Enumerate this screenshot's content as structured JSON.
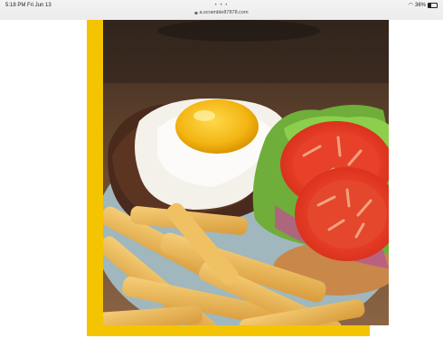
{
  "status_bar": {
    "time": "5:18 PM  Fri Jun 13",
    "battery": "36%",
    "dots": "• • •"
  },
  "browser": {
    "url": "a.scramble87878.com"
  },
  "colors": {
    "frame_accent": "#f5c400"
  },
  "icons": {
    "wifi": "wifi-icon",
    "battery": "battery-icon",
    "lock": "lock-icon"
  }
}
